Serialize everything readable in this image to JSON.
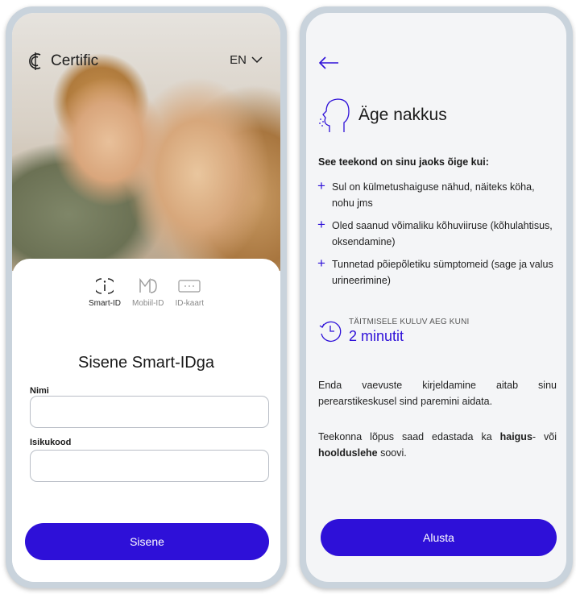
{
  "login_screen": {
    "brand_name": "Certific",
    "language": "EN",
    "auth_methods": [
      {
        "label": "Smart-ID",
        "icon": "smart-id-icon",
        "active": true
      },
      {
        "label": "Mobiil-ID",
        "icon": "mobiil-id-icon",
        "active": false
      },
      {
        "label": "ID-kaart",
        "icon": "id-card-icon",
        "active": false
      }
    ],
    "title": "Sisene Smart-IDga",
    "name_field": {
      "label": "Nimi",
      "value": "",
      "placeholder": ""
    },
    "id_field": {
      "label": "Isikukood",
      "value": "",
      "placeholder": ""
    },
    "submit_label": "Sisene"
  },
  "journey_screen": {
    "title": "Äge nakkus",
    "intro": "See teekond on sinu jaoks õige kui:",
    "bullets": [
      "Sul on külmetushaiguse nähud, näiteks köha, nohu jms",
      "Oled saanud võimaliku kõhuviiruse (kõhulahtisus, oksendamine)",
      "Tunnetad põiepõletiku sümptomeid (sage ja valus urineerimine)"
    ],
    "time_label": "TÄITMISELE KULUV AEG KUNI",
    "time_value": "2 minutit",
    "paragraph1": "Enda vaevuste kirjeldamine aitab sinu perearstikeskusel sind paremini aidata.",
    "paragraph2": {
      "before": "Teekonna lõpus saad edastada ka ",
      "bold1": "haigus",
      "middle": "- või ",
      "bold2": "hoolduslehe",
      "after": " soovi."
    },
    "start_label": "Alusta"
  },
  "colors": {
    "accent": "#2e10d8",
    "frame": "#c9d3dc",
    "screen_bg": "#f4f5f7"
  }
}
